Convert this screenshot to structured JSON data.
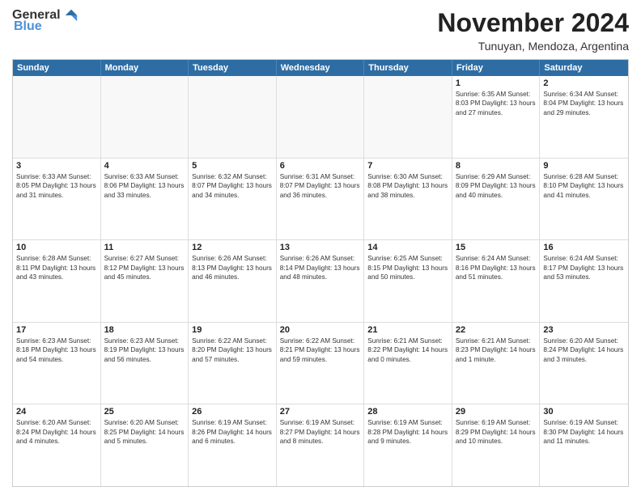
{
  "logo": {
    "general": "General",
    "blue": "Blue"
  },
  "title": "November 2024",
  "location": "Tunuyan, Mendoza, Argentina",
  "days_of_week": [
    "Sunday",
    "Monday",
    "Tuesday",
    "Wednesday",
    "Thursday",
    "Friday",
    "Saturday"
  ],
  "weeks": [
    [
      {
        "day": "",
        "info": ""
      },
      {
        "day": "",
        "info": ""
      },
      {
        "day": "",
        "info": ""
      },
      {
        "day": "",
        "info": ""
      },
      {
        "day": "",
        "info": ""
      },
      {
        "day": "1",
        "info": "Sunrise: 6:35 AM\nSunset: 8:03 PM\nDaylight: 13 hours and 27 minutes."
      },
      {
        "day": "2",
        "info": "Sunrise: 6:34 AM\nSunset: 8:04 PM\nDaylight: 13 hours and 29 minutes."
      }
    ],
    [
      {
        "day": "3",
        "info": "Sunrise: 6:33 AM\nSunset: 8:05 PM\nDaylight: 13 hours and 31 minutes."
      },
      {
        "day": "4",
        "info": "Sunrise: 6:33 AM\nSunset: 8:06 PM\nDaylight: 13 hours and 33 minutes."
      },
      {
        "day": "5",
        "info": "Sunrise: 6:32 AM\nSunset: 8:07 PM\nDaylight: 13 hours and 34 minutes."
      },
      {
        "day": "6",
        "info": "Sunrise: 6:31 AM\nSunset: 8:07 PM\nDaylight: 13 hours and 36 minutes."
      },
      {
        "day": "7",
        "info": "Sunrise: 6:30 AM\nSunset: 8:08 PM\nDaylight: 13 hours and 38 minutes."
      },
      {
        "day": "8",
        "info": "Sunrise: 6:29 AM\nSunset: 8:09 PM\nDaylight: 13 hours and 40 minutes."
      },
      {
        "day": "9",
        "info": "Sunrise: 6:28 AM\nSunset: 8:10 PM\nDaylight: 13 hours and 41 minutes."
      }
    ],
    [
      {
        "day": "10",
        "info": "Sunrise: 6:28 AM\nSunset: 8:11 PM\nDaylight: 13 hours and 43 minutes."
      },
      {
        "day": "11",
        "info": "Sunrise: 6:27 AM\nSunset: 8:12 PM\nDaylight: 13 hours and 45 minutes."
      },
      {
        "day": "12",
        "info": "Sunrise: 6:26 AM\nSunset: 8:13 PM\nDaylight: 13 hours and 46 minutes."
      },
      {
        "day": "13",
        "info": "Sunrise: 6:26 AM\nSunset: 8:14 PM\nDaylight: 13 hours and 48 minutes."
      },
      {
        "day": "14",
        "info": "Sunrise: 6:25 AM\nSunset: 8:15 PM\nDaylight: 13 hours and 50 minutes."
      },
      {
        "day": "15",
        "info": "Sunrise: 6:24 AM\nSunset: 8:16 PM\nDaylight: 13 hours and 51 minutes."
      },
      {
        "day": "16",
        "info": "Sunrise: 6:24 AM\nSunset: 8:17 PM\nDaylight: 13 hours and 53 minutes."
      }
    ],
    [
      {
        "day": "17",
        "info": "Sunrise: 6:23 AM\nSunset: 8:18 PM\nDaylight: 13 hours and 54 minutes."
      },
      {
        "day": "18",
        "info": "Sunrise: 6:23 AM\nSunset: 8:19 PM\nDaylight: 13 hours and 56 minutes."
      },
      {
        "day": "19",
        "info": "Sunrise: 6:22 AM\nSunset: 8:20 PM\nDaylight: 13 hours and 57 minutes."
      },
      {
        "day": "20",
        "info": "Sunrise: 6:22 AM\nSunset: 8:21 PM\nDaylight: 13 hours and 59 minutes."
      },
      {
        "day": "21",
        "info": "Sunrise: 6:21 AM\nSunset: 8:22 PM\nDaylight: 14 hours and 0 minutes."
      },
      {
        "day": "22",
        "info": "Sunrise: 6:21 AM\nSunset: 8:23 PM\nDaylight: 14 hours and 1 minute."
      },
      {
        "day": "23",
        "info": "Sunrise: 6:20 AM\nSunset: 8:24 PM\nDaylight: 14 hours and 3 minutes."
      }
    ],
    [
      {
        "day": "24",
        "info": "Sunrise: 6:20 AM\nSunset: 8:24 PM\nDaylight: 14 hours and 4 minutes."
      },
      {
        "day": "25",
        "info": "Sunrise: 6:20 AM\nSunset: 8:25 PM\nDaylight: 14 hours and 5 minutes."
      },
      {
        "day": "26",
        "info": "Sunrise: 6:19 AM\nSunset: 8:26 PM\nDaylight: 14 hours and 6 minutes."
      },
      {
        "day": "27",
        "info": "Sunrise: 6:19 AM\nSunset: 8:27 PM\nDaylight: 14 hours and 8 minutes."
      },
      {
        "day": "28",
        "info": "Sunrise: 6:19 AM\nSunset: 8:28 PM\nDaylight: 14 hours and 9 minutes."
      },
      {
        "day": "29",
        "info": "Sunrise: 6:19 AM\nSunset: 8:29 PM\nDaylight: 14 hours and 10 minutes."
      },
      {
        "day": "30",
        "info": "Sunrise: 6:19 AM\nSunset: 8:30 PM\nDaylight: 14 hours and 11 minutes."
      }
    ]
  ]
}
